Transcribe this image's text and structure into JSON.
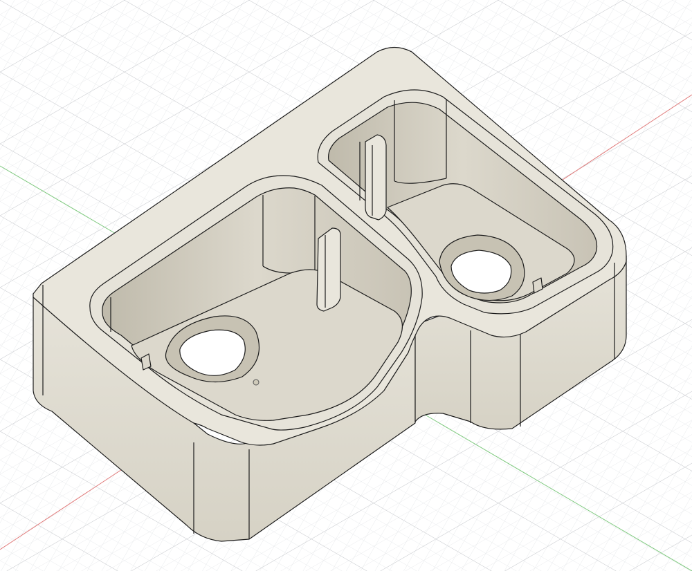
{
  "viewport": {
    "background": "#ffffff",
    "grid_major_color": "#c9cbcf",
    "grid_minor_color": "#e2e4e7",
    "x_axis_color": "#e07a7a",
    "y_axis_color": "#7fc97f"
  },
  "model": {
    "face_color": "#ebe8e0",
    "top_color": "#e9e6dc",
    "side_color": "#d9d5c8",
    "shadow_color": "#bdb8aa",
    "edge_color": "#1b1b1b",
    "origin_marker_icon": "origin-point-icon"
  }
}
